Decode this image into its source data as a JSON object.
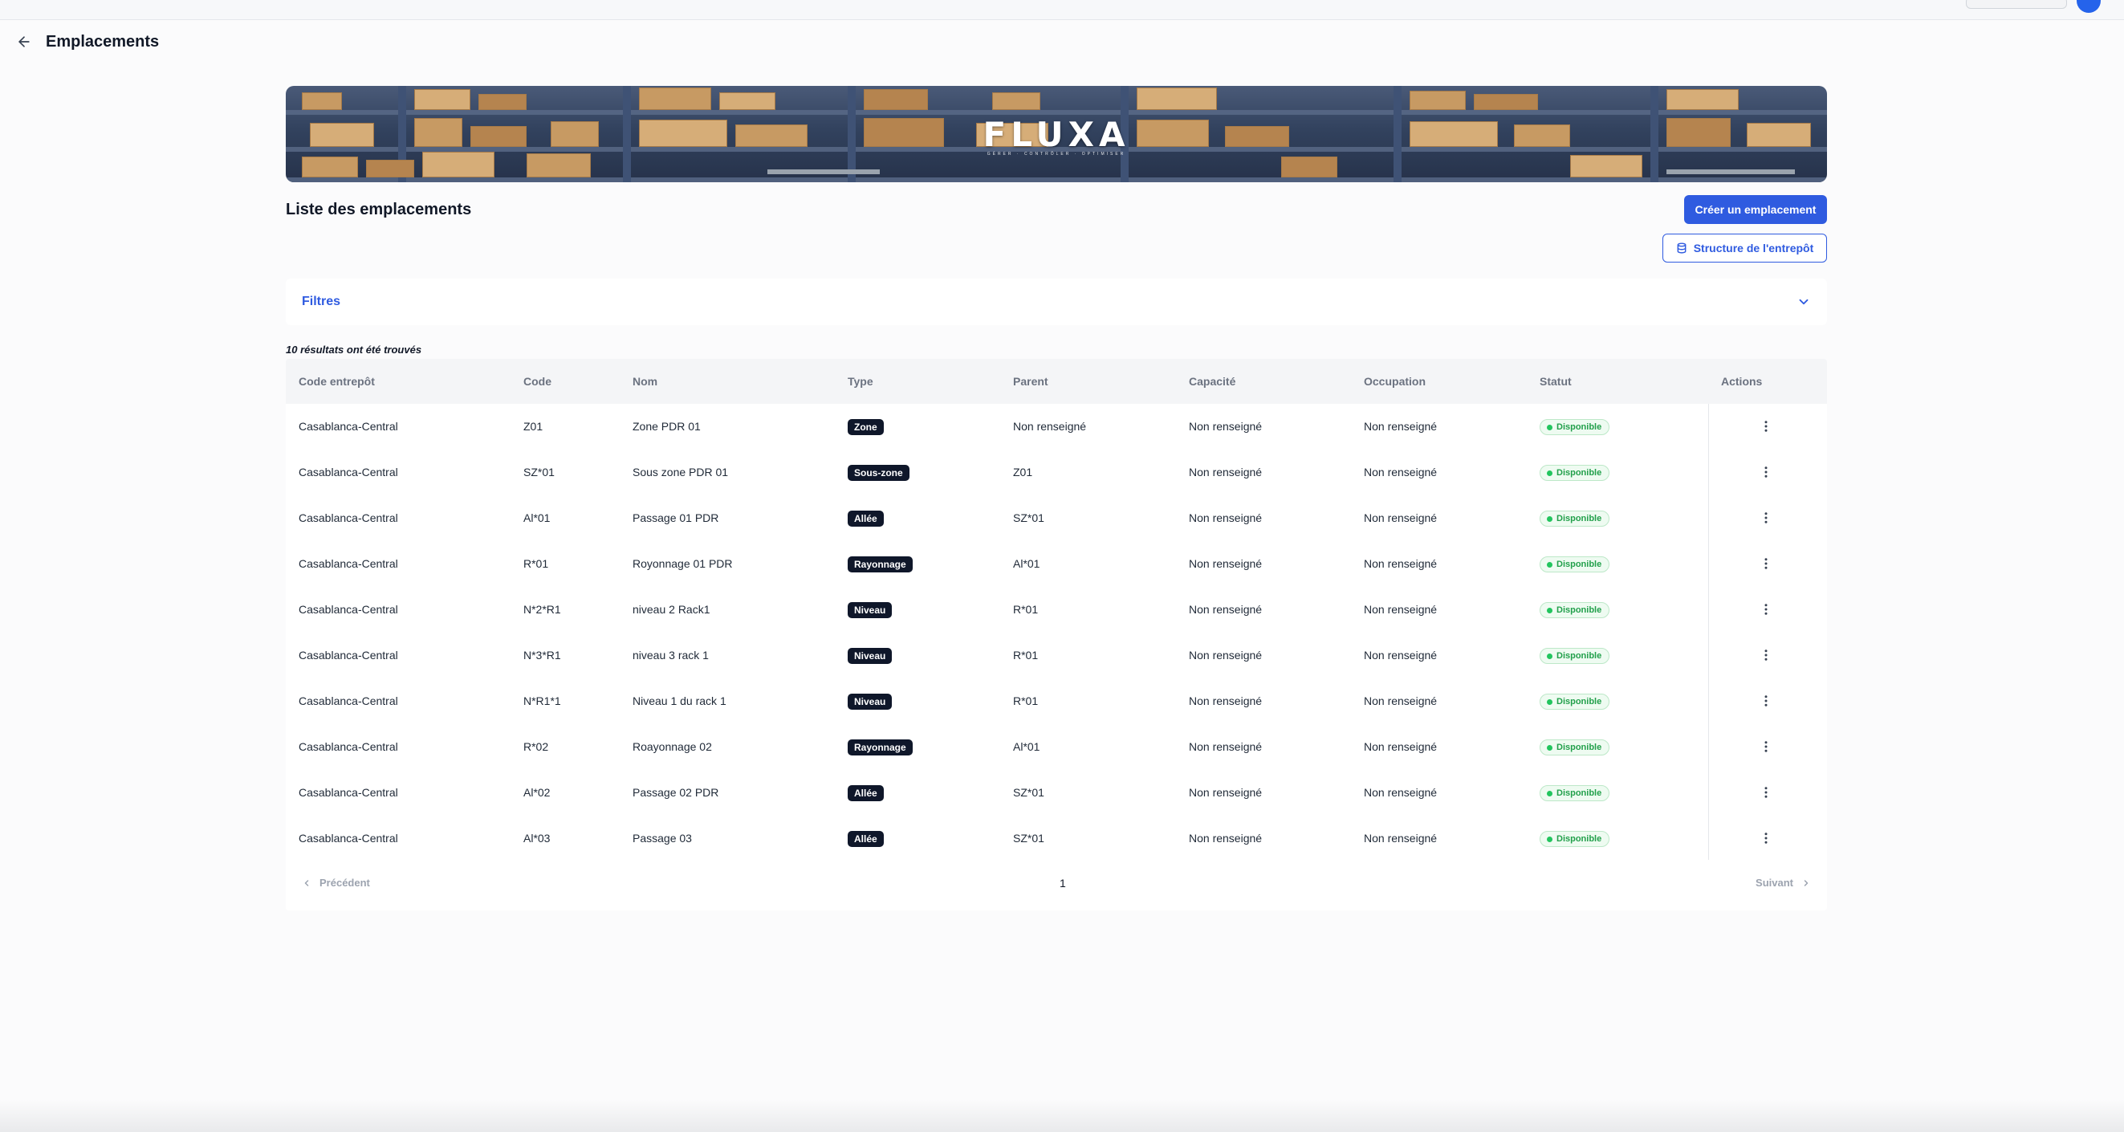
{
  "page": {
    "title": "Emplacements"
  },
  "banner": {
    "logo_text": "FLUXA",
    "logo_subtext": "GÉRER · CONTRÔLER · OPTIMISER"
  },
  "section": {
    "title": "Liste des emplacements",
    "create_button": "Créer un emplacement",
    "structure_button": "Structure de l'entrepôt"
  },
  "filters": {
    "label": "Filtres"
  },
  "results": {
    "count_text": "10 résultats ont été trouvés"
  },
  "table": {
    "headers": [
      "Code entrepôt",
      "Code",
      "Nom",
      "Type",
      "Parent",
      "Capacité",
      "Occupation",
      "Statut",
      "Actions"
    ],
    "rows": [
      {
        "warehouse": "Casablanca-Central",
        "code": "Z01",
        "name": "Zone PDR 01",
        "type": "Zone",
        "parent": "Non renseigné",
        "capacity": "Non renseigné",
        "occupation": "Non renseigné",
        "status": "Disponible"
      },
      {
        "warehouse": "Casablanca-Central",
        "code": "SZ*01",
        "name": "Sous zone PDR 01",
        "type": "Sous-zone",
        "parent": "Z01",
        "capacity": "Non renseigné",
        "occupation": "Non renseigné",
        "status": "Disponible"
      },
      {
        "warehouse": "Casablanca-Central",
        "code": "Al*01",
        "name": "Passage 01 PDR",
        "type": "Allée",
        "parent": "SZ*01",
        "capacity": "Non renseigné",
        "occupation": "Non renseigné",
        "status": "Disponible"
      },
      {
        "warehouse": "Casablanca-Central",
        "code": "R*01",
        "name": "Royonnage 01 PDR",
        "type": "Rayonnage",
        "parent": "Al*01",
        "capacity": "Non renseigné",
        "occupation": "Non renseigné",
        "status": "Disponible"
      },
      {
        "warehouse": "Casablanca-Central",
        "code": "N*2*R1",
        "name": "niveau 2 Rack1",
        "type": "Niveau",
        "parent": "R*01",
        "capacity": "Non renseigné",
        "occupation": "Non renseigné",
        "status": "Disponible"
      },
      {
        "warehouse": "Casablanca-Central",
        "code": "N*3*R1",
        "name": "niveau 3 rack 1",
        "type": "Niveau",
        "parent": "R*01",
        "capacity": "Non renseigné",
        "occupation": "Non renseigné",
        "status": "Disponible"
      },
      {
        "warehouse": "Casablanca-Central",
        "code": "N*R1*1",
        "name": "Niveau 1 du rack 1",
        "type": "Niveau",
        "parent": "R*01",
        "capacity": "Non renseigné",
        "occupation": "Non renseigné",
        "status": "Disponible"
      },
      {
        "warehouse": "Casablanca-Central",
        "code": "R*02",
        "name": "Roayonnage 02",
        "type": "Rayonnage",
        "parent": "Al*01",
        "capacity": "Non renseigné",
        "occupation": "Non renseigné",
        "status": "Disponible"
      },
      {
        "warehouse": "Casablanca-Central",
        "code": "Al*02",
        "name": "Passage 02 PDR",
        "type": "Allée",
        "parent": "SZ*01",
        "capacity": "Non renseigné",
        "occupation": "Non renseigné",
        "status": "Disponible"
      },
      {
        "warehouse": "Casablanca-Central",
        "code": "Al*03",
        "name": "Passage 03",
        "type": "Allée",
        "parent": "SZ*01",
        "capacity": "Non renseigné",
        "occupation": "Non renseigné",
        "status": "Disponible"
      }
    ]
  },
  "pagination": {
    "prev_label": "Précédent",
    "current_page": "1",
    "next_label": "Suivant"
  },
  "icons": {
    "back": "arrow-left-icon",
    "filters_toggle": "chevron-down-icon",
    "structure": "database-icon",
    "row_actions": "more-vertical-icon",
    "prev": "chevron-left-icon",
    "next": "chevron-right-icon"
  },
  "colors": {
    "accent": "#2f5be0",
    "badge_dark": "#0f172a",
    "status_green": "#22a04b"
  }
}
